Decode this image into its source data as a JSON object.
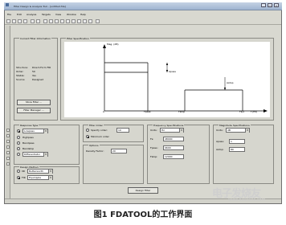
{
  "window": {
    "title": "Filter Design & Analysis Tool - [untitled.fda]",
    "controls": {
      "minimize": "_",
      "maximize": "□",
      "close": "x"
    }
  },
  "menu": [
    "File",
    "Edit",
    "Analysis",
    "Targets",
    "View",
    "Window",
    "Help"
  ],
  "current_filter_info": {
    "title": "Current Filter Information",
    "rows": [
      {
        "label": "Structure:",
        "value": "Direct-Form FIR"
      },
      {
        "label": "Order:",
        "value": "50"
      },
      {
        "label": "Stable:",
        "value": "Yes"
      },
      {
        "label": "Source:",
        "value": "Designed"
      }
    ],
    "store_button": "Store Filter ...",
    "manager_button": "Filter Manager ..."
  },
  "filter_specification": {
    "title": "Filter Specification",
    "y_label": "Mag. (dB)",
    "x_label": "f (Hz)",
    "tick_zero": "0",
    "fpass": "Fpass",
    "fstop": "Fstop",
    "fs2": "Fs/2",
    "apass": "Apass",
    "astop": "Astop"
  },
  "response_type": {
    "title": "Response Type",
    "options": [
      "Lowpass",
      "Highpass",
      "Bandpass",
      "Bandstop",
      "Differentiator"
    ],
    "selected_index": 0,
    "design_method": {
      "title": "Design Method",
      "iir_label": "IIR",
      "iir_value": "Butterworth",
      "fir_label": "FIR",
      "fir_value": "Equiripple",
      "selected": "FIR"
    }
  },
  "filter_order": {
    "title": "Filter Order",
    "specify_label": "Specify order:",
    "specify_value": "10",
    "minimum_label": "Minimum order",
    "selected": "minimum"
  },
  "options": {
    "title": "Options",
    "density_label": "Density Factor:",
    "density_value": "20"
  },
  "frequency_specs": {
    "title": "Frequency Specifications",
    "units_label": "Units:",
    "units_value": "Hz",
    "fields": [
      {
        "label": "Fs:",
        "value": "48000"
      },
      {
        "label": "Fpass:",
        "value": "9600"
      },
      {
        "label": "Fstop:",
        "value": "12000"
      }
    ]
  },
  "magnitude_specs": {
    "title": "Magnitude Specifications",
    "units_label": "Units:",
    "units_value": "dB",
    "fields": [
      {
        "label": "Apass:",
        "value": "1"
      },
      {
        "label": "Astop:",
        "value": "80"
      }
    ]
  },
  "design_button": "Design Filter",
  "caption": "图1  FDATOOL的工作界面",
  "watermark": "电子发烧友",
  "watermark_url": "www.elecfans.com"
}
